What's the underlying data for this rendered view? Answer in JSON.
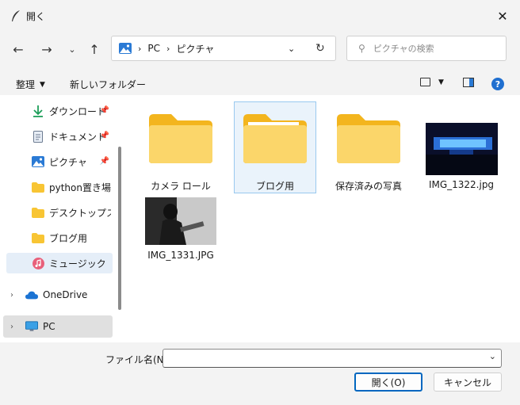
{
  "window": {
    "title": "開く"
  },
  "address": {
    "segments": [
      "PC",
      "ピクチャ"
    ]
  },
  "search": {
    "placeholder": "ピクチャの検索"
  },
  "command_bar": {
    "organize_label": "整理",
    "new_folder_label": "新しいフォルダー"
  },
  "sidebar": {
    "items": [
      {
        "label": "ダウンロード",
        "icon": "download-icon",
        "pinned": true
      },
      {
        "label": "ドキュメント",
        "icon": "document-icon",
        "pinned": true
      },
      {
        "label": "ピクチャ",
        "icon": "pictures-icon",
        "pinned": true
      },
      {
        "label": "python置き場",
        "icon": "folder-icon",
        "pinned": false
      },
      {
        "label": "デスクトップスライ",
        "icon": "folder-icon",
        "pinned": false
      },
      {
        "label": "ブログ用",
        "icon": "folder-icon",
        "pinned": false
      },
      {
        "label": "ミュージック",
        "icon": "music-icon",
        "pinned": false,
        "selected": true
      },
      {
        "label": "OneDrive",
        "icon": "onedrive-icon",
        "pinned": false
      },
      {
        "label": "PC",
        "icon": "pc-icon",
        "pinned": false,
        "selected": true
      }
    ]
  },
  "files": [
    {
      "name": "カメラ ロール",
      "type": "folder"
    },
    {
      "name": "ブログ用",
      "type": "folder",
      "selected": true
    },
    {
      "name": "保存済みの写真",
      "type": "folder"
    },
    {
      "name": "IMG_1322.jpg",
      "type": "image"
    },
    {
      "name": "IMG_1331.JPG",
      "type": "image"
    }
  ],
  "bottom": {
    "filename_label": "ファイル名(N):",
    "filename_value": "",
    "open_label": "開く(O)",
    "cancel_label": "キャンセル"
  },
  "colors": {
    "accent": "#0067c0",
    "folder": "#f8c534",
    "selection": "#cce4f7"
  }
}
